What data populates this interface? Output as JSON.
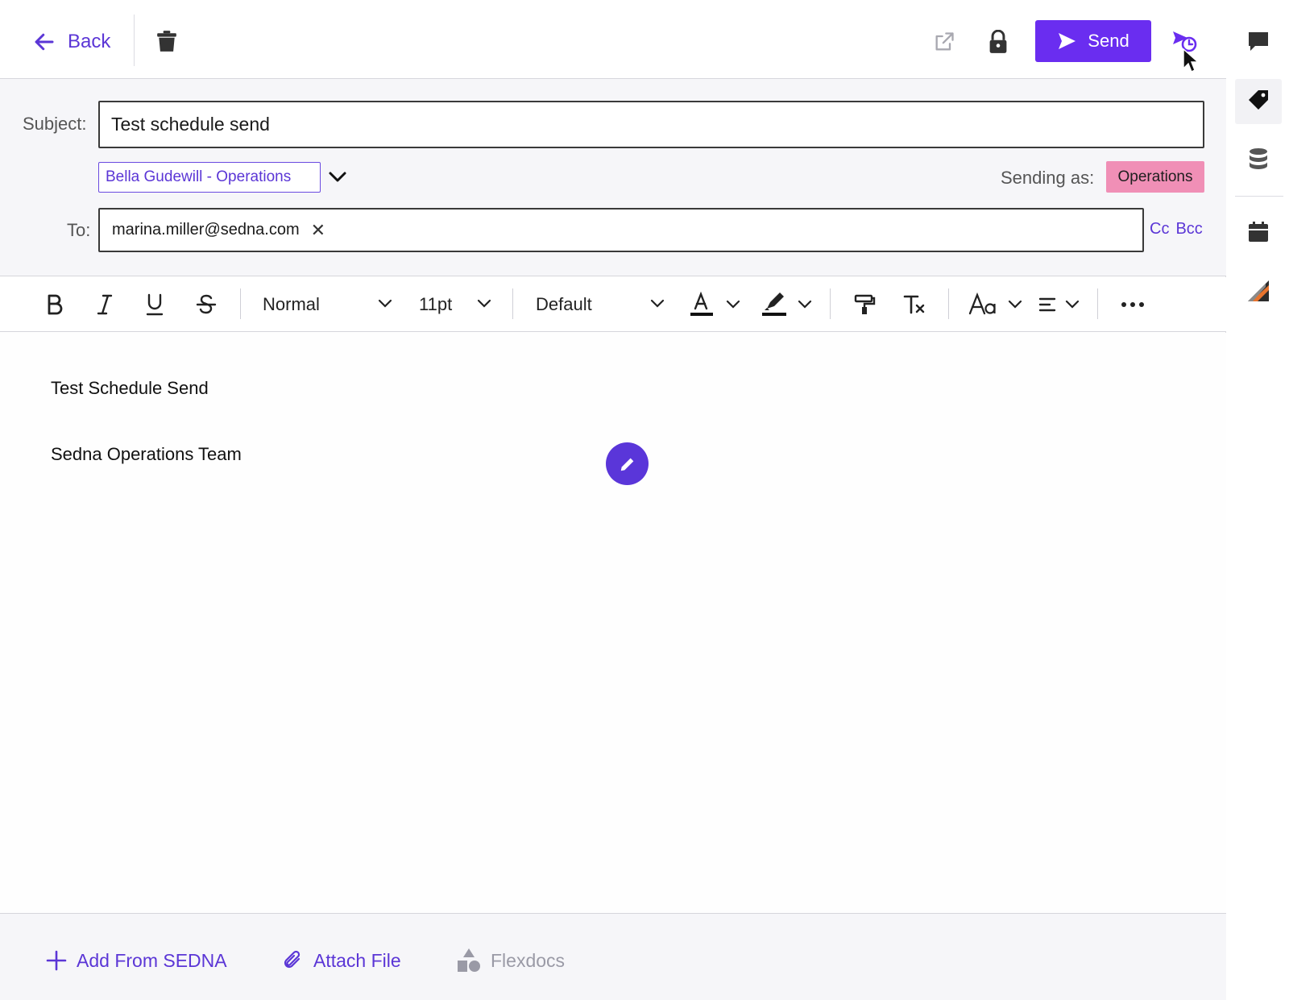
{
  "topbar": {
    "back_label": "Back",
    "send_label": "Send"
  },
  "header": {
    "subject_label": "Subject:",
    "subject_value": "Test schedule send",
    "from_value": "Bella Gudewill - Operations",
    "sending_as_label": "Sending as:",
    "sending_as_value": "Operations",
    "to_label": "To:",
    "to_recipients": [
      "marina.miller@sedna.com"
    ],
    "cc_label": "Cc",
    "bcc_label": "Bcc"
  },
  "toolbar": {
    "paragraph_style": "Normal",
    "font_size": "11pt",
    "font_family": "Default",
    "more_icon": "more-horizontal-icon"
  },
  "editor": {
    "lines": [
      "Test Schedule Send",
      "Sedna Operations Team"
    ]
  },
  "footer": {
    "add_from_label": "Add From SEDNA",
    "attach_label": "Attach File",
    "flexdocs_label": "Flexdocs"
  },
  "colors": {
    "accent": "#6a2df0",
    "link": "#5b36d6",
    "badge": "#f08fb6"
  }
}
